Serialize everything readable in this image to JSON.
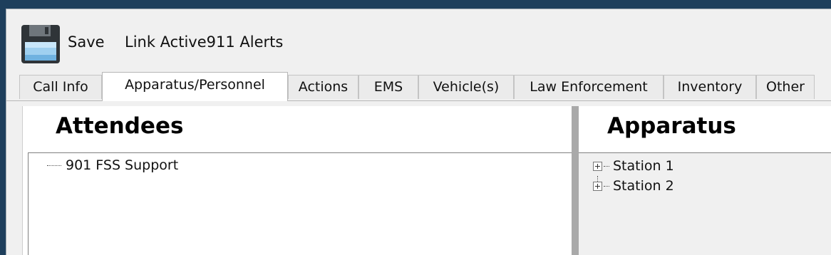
{
  "toolbar": {
    "save_label": "Save",
    "link_label": "Link Active911 Alerts"
  },
  "tabs": [
    {
      "label": "Call Info"
    },
    {
      "label": "Apparatus/Personnel",
      "active": true
    },
    {
      "label": "Actions"
    },
    {
      "label": "EMS"
    },
    {
      "label": "Vehicle(s)"
    },
    {
      "label": "Law Enforcement"
    },
    {
      "label": "Inventory"
    },
    {
      "label": "Other"
    }
  ],
  "attendees": {
    "title": "Attendees",
    "items": [
      {
        "label": "901 FSS Support"
      }
    ]
  },
  "apparatus": {
    "title": "Apparatus",
    "items": [
      {
        "label": "Station 1",
        "expander": "+"
      },
      {
        "label": "Station 2",
        "expander": "+"
      }
    ]
  },
  "colors": {
    "desktop": "#1e3f5c",
    "window": "#f0f0f0",
    "splitter": "#a9a9a9"
  },
  "icons": [
    "save-icon",
    "expand-icon"
  ]
}
